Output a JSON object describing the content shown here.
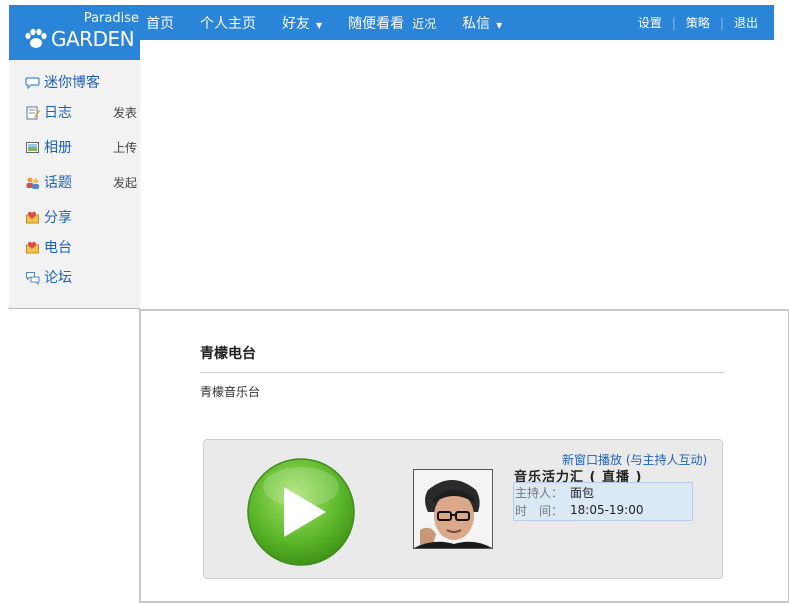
{
  "logo": {
    "small": "Paradise",
    "big": "GARDEN"
  },
  "nav": {
    "items": [
      {
        "label": "首页"
      },
      {
        "label": "个人主页"
      },
      {
        "label": "好友",
        "caret": "▼"
      },
      {
        "label": "随便看看",
        "sub": "近况"
      },
      {
        "label": "私信",
        "caret": "▼"
      }
    ],
    "right": [
      "设置",
      "策略",
      "退出"
    ],
    "separator": "|"
  },
  "sidebar": {
    "items": [
      {
        "label": "迷你博客",
        "icon": "chat-bubble-icon",
        "action": ""
      },
      {
        "label": "日志",
        "icon": "notepad-icon",
        "action": "发表"
      },
      {
        "label": "相册",
        "icon": "picture-icon",
        "action": "上传"
      },
      {
        "label": "话题",
        "icon": "people-icon",
        "action": "发起"
      },
      {
        "label": "分享",
        "icon": "share-icon",
        "action": ""
      },
      {
        "label": "电台",
        "icon": "radio-icon",
        "action": ""
      },
      {
        "label": "论坛",
        "icon": "forum-bubbles-icon",
        "action": ""
      }
    ]
  },
  "station": {
    "title": "青檬电台",
    "description": "青檬音乐台"
  },
  "player": {
    "popout_link": "新窗口播放 (与主持人互动)",
    "show_name": "音乐活力汇 ( 直播 )",
    "host_label": "主持人：",
    "host_value": "面包",
    "time_label": "时　间：",
    "time_value": "18:05-19:00"
  },
  "colors": {
    "nav_blue": "#2a84d8",
    "link_blue": "#1e63b8",
    "play_green": "#5cb82a"
  }
}
